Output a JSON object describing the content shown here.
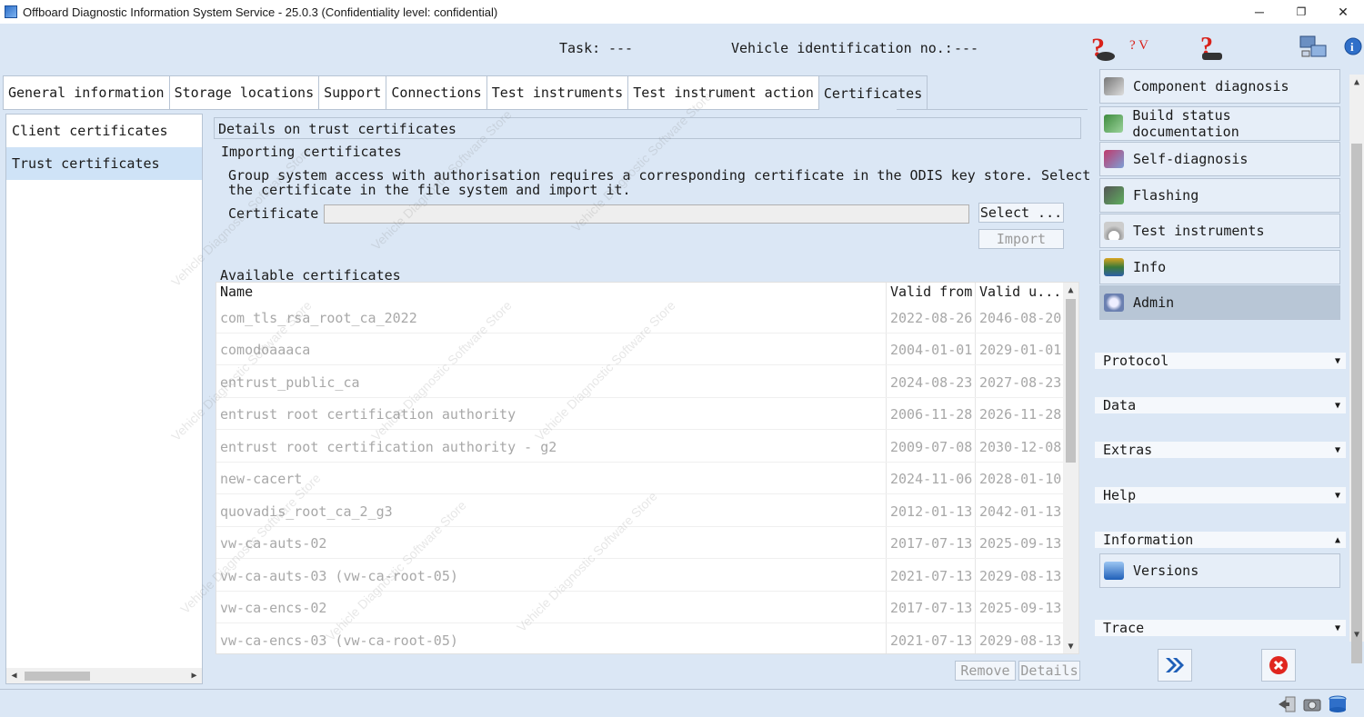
{
  "window": {
    "title": "Offboard Diagnostic Information System Service - 25.0.3 (Confidentiality level: confidential)",
    "minimize": "─",
    "maximize": "❐",
    "close": "✕"
  },
  "header": {
    "task_label": "Task:",
    "task_value": "---",
    "vin_label": "Vehicle identification no.:",
    "vin_value": "---",
    "help_version_text": "? V"
  },
  "tabs": [
    "General information",
    "Storage locations",
    "Support",
    "Connections",
    "Test instruments",
    "Test instrument action",
    "Certificates"
  ],
  "left": {
    "items": [
      "Client certificates",
      "Trust certificates"
    ]
  },
  "details": {
    "title": "Details on trust certificates",
    "importing_heading": "Importing certificates",
    "importing_text_line1": "Group system access with authorisation requires a corresponding certificate in the ODIS key store. Select",
    "importing_text_line2": "the certificate in the file system and import it.",
    "certificate_label": "Certificate",
    "certificate_value": "",
    "select_button": "Select ...",
    "import_button": "Import",
    "available_heading": "Available certificates",
    "remove_button": "Remove",
    "details_button": "Details"
  },
  "table": {
    "headers": [
      "Name",
      "Valid from",
      "Valid u..."
    ],
    "rows": [
      [
        "com_tls_rsa_root_ca_2022",
        "2022-08-26",
        "2046-08-20"
      ],
      [
        "comodoaaaca",
        "2004-01-01",
        "2029-01-01"
      ],
      [
        "entrust_public_ca",
        "2024-08-23",
        "2027-08-23"
      ],
      [
        "entrust root certification authority",
        "2006-11-28",
        "2026-11-28"
      ],
      [
        "entrust root certification authority - g2",
        "2009-07-08",
        "2030-12-08"
      ],
      [
        "new-cacert",
        "2024-11-06",
        "2028-01-10"
      ],
      [
        "quovadis_root_ca_2_g3",
        "2012-01-13",
        "2042-01-13"
      ],
      [
        "vw-ca-auts-02",
        "2017-07-13",
        "2025-09-13"
      ],
      [
        "vw-ca-auts-03 (vw-ca-root-05)",
        "2021-07-13",
        "2029-08-13"
      ],
      [
        "vw-ca-encs-02",
        "2017-07-13",
        "2025-09-13"
      ],
      [
        "vw-ca-encs-03 (vw-ca-root-05)",
        "2021-07-13",
        "2029-08-13"
      ]
    ]
  },
  "watermark": "Vehicle Diagnostic Software Store",
  "right": {
    "buttons": [
      {
        "label": "Component diagnosis",
        "icon": "component-diagnosis-icon"
      },
      {
        "label": "Build status documentation",
        "icon": "build-status-icon"
      },
      {
        "label": "Self-diagnosis",
        "icon": "self-diagnosis-icon"
      },
      {
        "label": "Flashing",
        "icon": "flashing-icon"
      },
      {
        "label": "Test instruments",
        "icon": "test-instruments-icon"
      },
      {
        "label": "Info",
        "icon": "info-books-icon"
      },
      {
        "label": "Admin",
        "icon": "admin-gear-icon"
      }
    ],
    "sections": [
      "Protocol",
      "Data",
      "Extras",
      "Help",
      "Information",
      "Trace"
    ],
    "versions_label": "Versions"
  },
  "colors": {
    "background": "#dbe7f5",
    "active_tab": "#dbe7f5",
    "selected_item": "#cfe3f7",
    "admin_active": "#b8c6d6",
    "help_red": "#d9211a"
  }
}
